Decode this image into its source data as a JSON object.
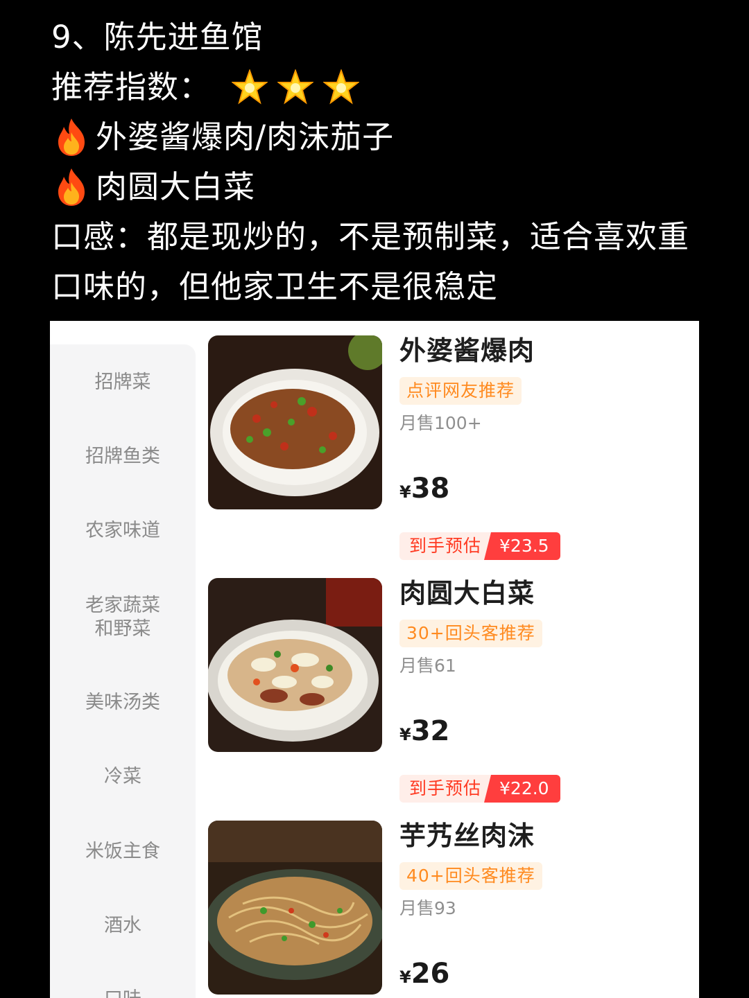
{
  "post": {
    "title": "9、陈先进鱼馆",
    "rating_label": "推荐指数：",
    "rating_stars": 3,
    "dish_line_1": "外婆酱爆肉/肉沫茄子",
    "dish_line_2": "肉圆大白菜",
    "review_line_1": "口感：都是现炒的，不是预制菜，适合喜欢重",
    "review_line_2": "口味的，但他家卫生不是很稳定"
  },
  "sidebar": {
    "categories": [
      {
        "label": "招牌菜"
      },
      {
        "label": "招牌鱼类"
      },
      {
        "label": "农家味道"
      },
      {
        "label": "老家蔬菜\n和野菜"
      },
      {
        "label": "美味汤类"
      },
      {
        "label": "冷菜"
      },
      {
        "label": "米饭主食"
      },
      {
        "label": "酒水"
      },
      {
        "label": "口味"
      }
    ]
  },
  "menu": {
    "items": [
      {
        "name": "外婆酱爆肉",
        "tag": "点评网友推荐",
        "sales": "月售100+",
        "currency": "¥",
        "price": "38",
        "estimate_label": "到手预估",
        "estimate_value": "¥23.5",
        "image_icon": "stir-fried-pork-dish"
      },
      {
        "name": "肉圆大白菜",
        "tag": "30+回头客推荐",
        "sales": "月售61",
        "currency": "¥",
        "price": "32",
        "estimate_label": "到手预估",
        "estimate_value": "¥22.0",
        "image_icon": "cabbage-meatball-dish"
      },
      {
        "name": "芋艿丝肉沫",
        "tag": "40+回头客推荐",
        "sales": "月售93",
        "currency": "¥",
        "price": "26",
        "image_icon": "shredded-noodle-dish"
      }
    ]
  },
  "colors": {
    "tag_text": "#ff8a1f",
    "estimate_red": "#ff3e3e",
    "sidebar_bg": "#f5f5f6"
  }
}
